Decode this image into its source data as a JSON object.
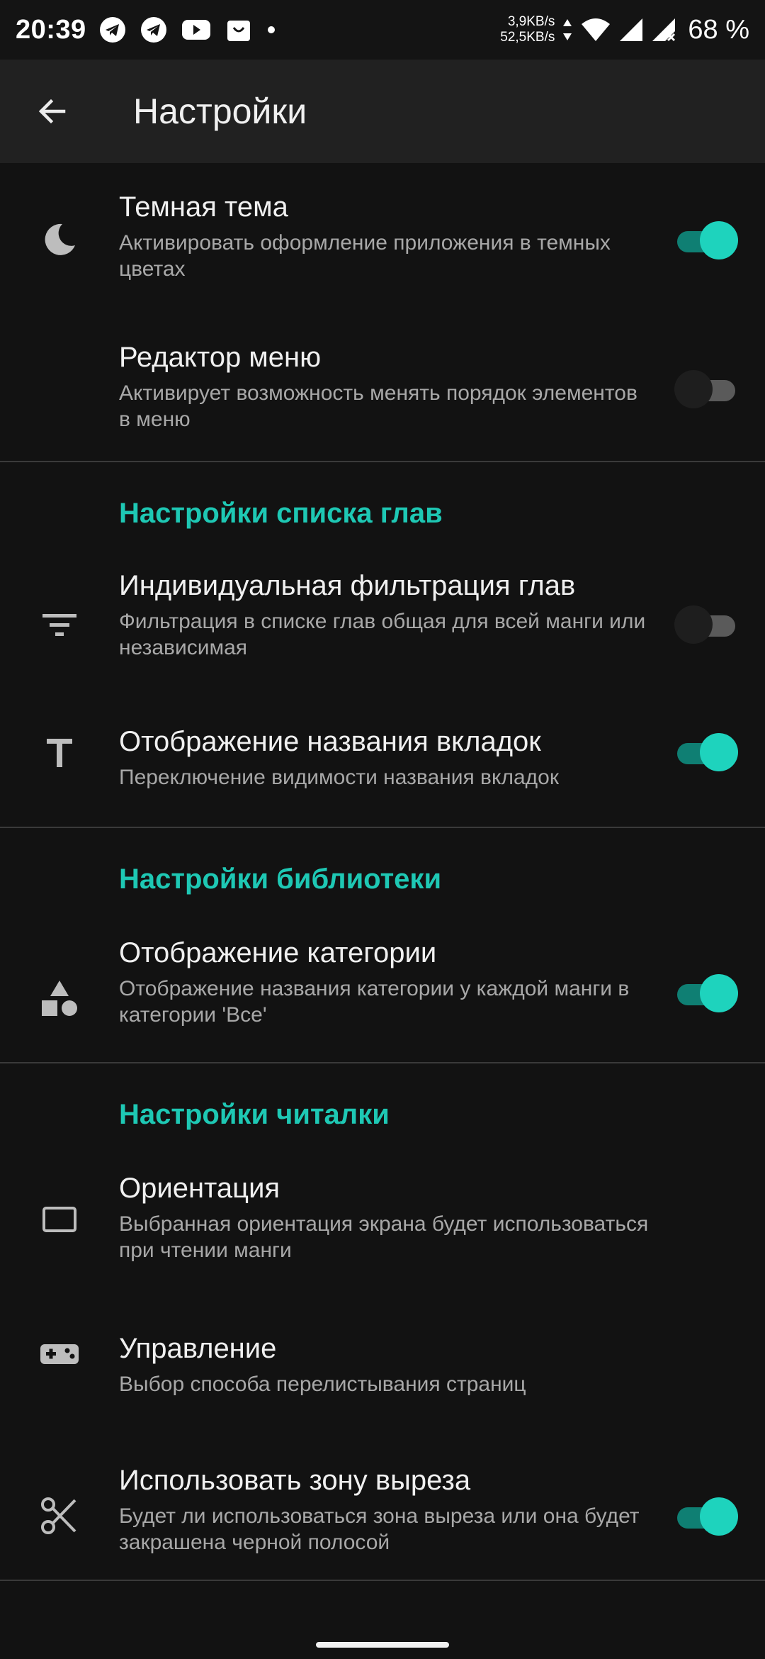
{
  "status": {
    "time": "20:39",
    "net_up": "3,9KB/s",
    "net_down": "52,5KB/s",
    "battery": "68 %"
  },
  "appbar": {
    "title": "Настройки",
    "back_icon": "arrow-back-icon"
  },
  "colors": {
    "accent": "#1ec8b4",
    "background": "#121212",
    "appbar": "#212121"
  },
  "prefs": {
    "dark_theme": {
      "title": "Темная тема",
      "summary": "Активировать оформление приложения в темных цветах",
      "icon": "moon-icon",
      "enabled": true
    },
    "menu_editor": {
      "title": "Редактор меню",
      "summary": "Активирует возможность менять порядок элементов в меню",
      "enabled": false
    },
    "chapters_header": "Настройки списка глав",
    "individual_filter": {
      "title": "Индивидуальная фильтрация глав",
      "summary": "Фильтрация в списке глав общая для всей манги или независимая",
      "icon": "filter-icon",
      "enabled": false
    },
    "tab_names": {
      "title": "Отображение названия вкладок",
      "summary": "Переключение видимости названия вкладок",
      "icon": "text-icon",
      "enabled": true
    },
    "library_header": "Настройки библиотеки",
    "category_display": {
      "title": "Отображение категории",
      "summary": "Отображение названия категории у каждой манги в категории 'Все'",
      "icon": "shapes-icon",
      "enabled": true
    },
    "reader_header": "Настройки читалки",
    "orientation": {
      "title": "Ориентация",
      "summary": "Выбранная ориентация экрана будет использоваться при чтении манги",
      "icon": "screen-rotation-icon"
    },
    "controls": {
      "title": "Управление",
      "summary": "Выбор способа перелистывания страниц",
      "icon": "gamepad-icon"
    },
    "cutout": {
      "title": "Использовать зону выреза",
      "summary": "Будет ли использоваться зона выреза или она будет закрашена черной полосой",
      "icon": "scissors-icon",
      "enabled": true
    }
  }
}
